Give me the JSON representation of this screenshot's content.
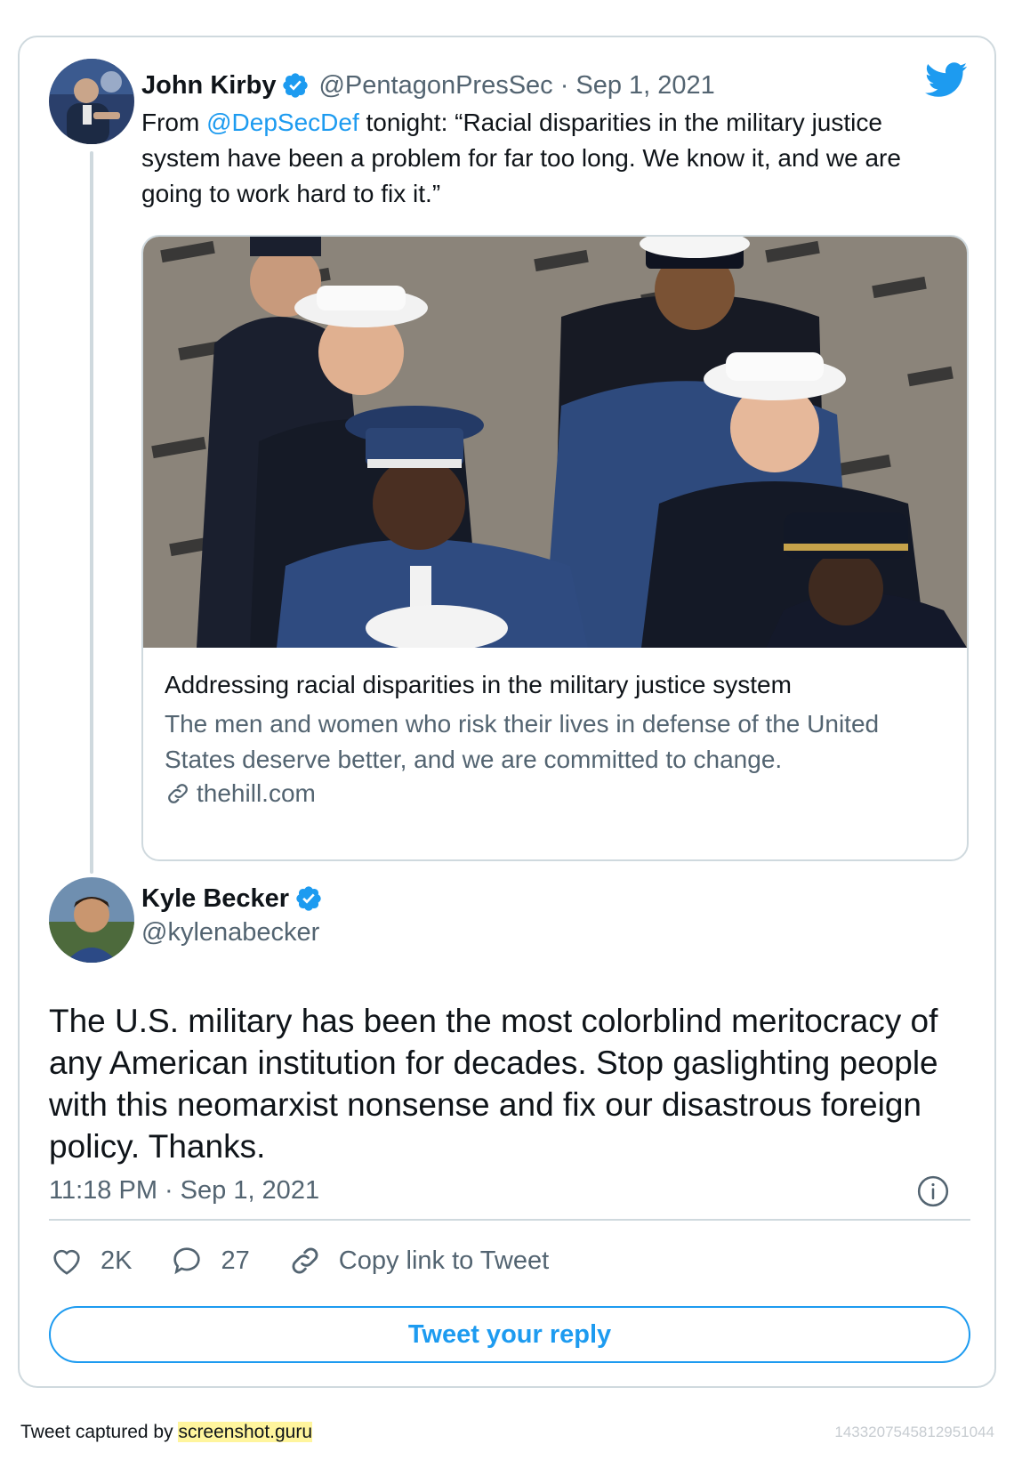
{
  "quoted_tweet": {
    "author_name": "John Kirby",
    "verified": true,
    "handle": "@PentagonPresSec",
    "separator": "·",
    "date": "Sep 1, 2021",
    "text_before_mention": "From ",
    "mention": "@DepSecDef",
    "text_after_mention": " tonight: “Racial disparities in the military justice system have been a problem for far too long. We know it, and we are going to work hard to fix it.”",
    "link_card": {
      "title": "Addressing racial disparities in the military justice system",
      "description": "The men and women who risk their lives in defense of the United States deserve better, and we are committed to change.",
      "domain": "thehill.com"
    }
  },
  "main_tweet": {
    "author_name": "Kyle Becker",
    "verified": true,
    "handle": "@kylenabecker",
    "text": "The U.S. military has been the most colorblind meritocracy of any American institution for decades. Stop gaslighting people with this neomarxist nonsense and fix our disastrous foreign policy. Thanks.",
    "time": "11:18 PM",
    "separator": "·",
    "date": "Sep 1, 2021",
    "actions": {
      "likes": "2K",
      "replies": "27",
      "copy_link": "Copy link to Tweet"
    },
    "reply_button": "Tweet your reply"
  },
  "footer": {
    "captured_prefix": "Tweet captured by ",
    "captured_site": "screenshot.guru",
    "tweet_id": "1433207545812951044"
  },
  "colors": {
    "accent": "#1d9bf0",
    "secondary_text": "#536471",
    "border": "#cfd9de",
    "highlight": "#fff59d"
  },
  "icons": [
    "verified-badge-icon",
    "twitter-bird-icon",
    "link-icon",
    "info-icon",
    "heart-icon",
    "reply-bubble-icon",
    "chain-link-icon"
  ]
}
